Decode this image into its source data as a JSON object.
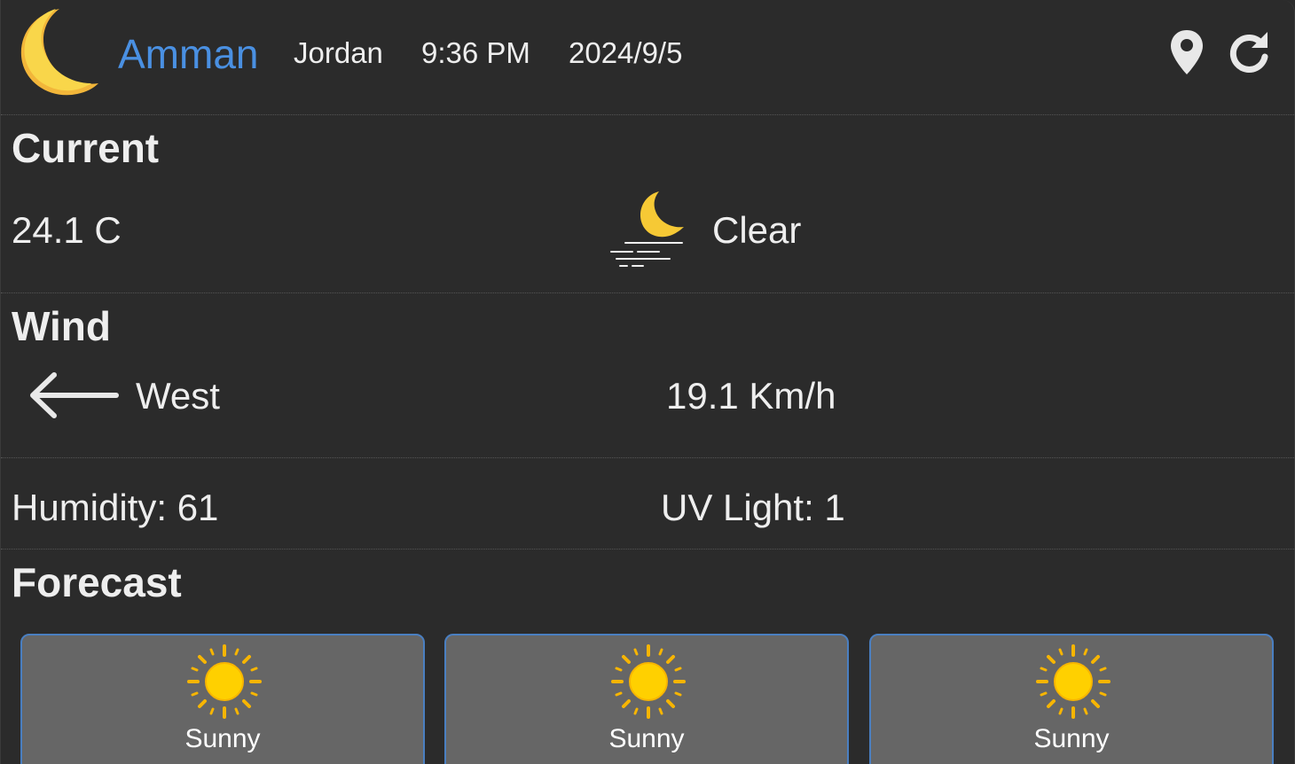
{
  "header": {
    "city": "Amman",
    "country": "Jordan",
    "time": "9:36 PM",
    "date": "2024/9/5",
    "icon": "moon-icon"
  },
  "current": {
    "title": "Current",
    "temperature": "24.1 C",
    "condition": "Clear",
    "condition_icon": "moon-fog-icon"
  },
  "wind": {
    "title": "Wind",
    "direction": "West",
    "speed": "19.1 Km/h",
    "arrow_icon": "arrow-left-icon"
  },
  "misc": {
    "humidity": "Humidity: 61",
    "uv": "UV Light: 1"
  },
  "forecast": {
    "title": "Forecast",
    "days": [
      {
        "condition": "Sunny",
        "icon": "sun-icon"
      },
      {
        "condition": "Sunny",
        "icon": "sun-icon"
      },
      {
        "condition": "Sunny",
        "icon": "sun-icon"
      }
    ]
  },
  "colors": {
    "background": "#2b2b2b",
    "city": "#4a90e2",
    "card": "#666666",
    "card_border": "#4a7fc1",
    "moon": "#f6c935",
    "sun": "#ffcc00"
  }
}
